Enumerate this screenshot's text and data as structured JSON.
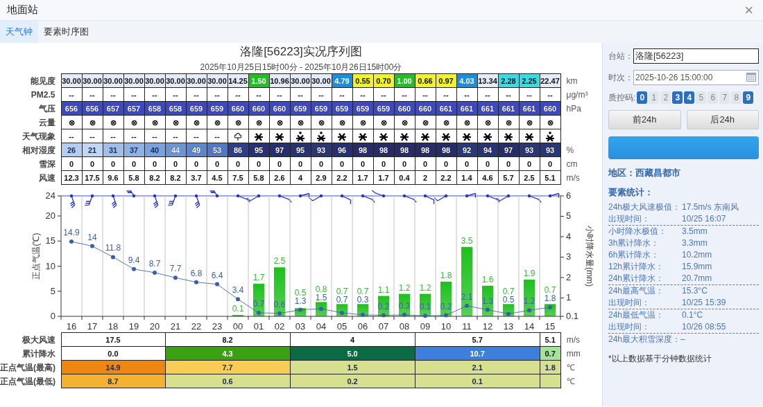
{
  "window": {
    "title": "地面站",
    "close": "×"
  },
  "tabs": [
    {
      "label": "天气钟",
      "selected": true
    },
    {
      "label": "要素时序图",
      "selected": false
    }
  ],
  "chart_title": "洛隆[56223]实况序列图",
  "chart_subtitle": "2025年10月25日15时00分 - 2025年10月26日15时00分",
  "elements_table": {
    "rows": [
      {
        "label": "能见度",
        "unit": "km",
        "kind": "plain",
        "cells": [
          {
            "text": "30.00",
            "color": "#e3ebf6"
          },
          {
            "text": "30.00",
            "color": "#e3ebf6"
          },
          {
            "text": "30.00",
            "color": "#e3ebf6"
          },
          {
            "text": "30.00",
            "color": "#e3ebf6"
          },
          {
            "text": "30.00",
            "color": "#e3ebf6"
          },
          {
            "text": "30.00",
            "color": "#e3ebf6"
          },
          {
            "text": "30.00",
            "color": "#e3ebf6"
          },
          {
            "text": "30.00",
            "color": "#e3ebf6"
          },
          {
            "text": "14.25",
            "color": "#e3ebf6"
          },
          {
            "text": "1.50",
            "color": "#22c022"
          },
          {
            "text": "10.96",
            "color": "#e3ebf6"
          },
          {
            "text": "30.00",
            "color": "#e3ebf6"
          },
          {
            "text": "30.00",
            "color": "#e3ebf6"
          },
          {
            "text": "4.79",
            "color": "#1a8fe0"
          },
          {
            "text": "0.55",
            "color": "#f2f224"
          },
          {
            "text": "0.70",
            "color": "#f2f224"
          },
          {
            "text": "1.00",
            "color": "#22c022"
          },
          {
            "text": "0.66",
            "color": "#f2f224"
          },
          {
            "text": "0.97",
            "color": "#f2f224"
          },
          {
            "text": "4.03",
            "color": "#1a8fe0"
          },
          {
            "text": "13.34",
            "color": "#e3ebf6"
          },
          {
            "text": "2.28",
            "color": "#32dfe8"
          },
          {
            "text": "2.25",
            "color": "#32dfe8"
          },
          {
            "text": "22.47",
            "color": "#e3ebf6"
          }
        ]
      },
      {
        "label": "PM2.5",
        "unit": "μg/m³",
        "kind": "plain",
        "cells": [
          {
            "text": "--"
          },
          {
            "text": "--"
          },
          {
            "text": "--"
          },
          {
            "text": "--"
          },
          {
            "text": "--"
          },
          {
            "text": "--"
          },
          {
            "text": "--"
          },
          {
            "text": "--"
          },
          {
            "text": "--"
          },
          {
            "text": "--"
          },
          {
            "text": "--"
          },
          {
            "text": "--"
          },
          {
            "text": "--"
          },
          {
            "text": "--"
          },
          {
            "text": "--"
          },
          {
            "text": "--"
          },
          {
            "text": "--"
          },
          {
            "text": "--"
          },
          {
            "text": "--"
          },
          {
            "text": "--"
          },
          {
            "text": "--"
          },
          {
            "text": "--"
          },
          {
            "text": "--"
          },
          {
            "text": "--"
          }
        ]
      },
      {
        "label": "气压",
        "unit": "hPa",
        "kind": "outlined",
        "color": "#3d48c4",
        "cells": [
          {
            "text": "656"
          },
          {
            "text": "656"
          },
          {
            "text": "657"
          },
          {
            "text": "657"
          },
          {
            "text": "658"
          },
          {
            "text": "658"
          },
          {
            "text": "659"
          },
          {
            "text": "659"
          },
          {
            "text": "660"
          },
          {
            "text": "660"
          },
          {
            "text": "660"
          },
          {
            "text": "659"
          },
          {
            "text": "659"
          },
          {
            "text": "659"
          },
          {
            "text": "659"
          },
          {
            "text": "659"
          },
          {
            "text": "660"
          },
          {
            "text": "660"
          },
          {
            "text": "661"
          },
          {
            "text": "661"
          },
          {
            "text": "661"
          },
          {
            "text": "661"
          },
          {
            "text": "661"
          },
          {
            "text": "660"
          }
        ]
      },
      {
        "label": "云量",
        "kind": "plain",
        "cells": [
          {
            "text": "⊗"
          },
          {
            "text": "⊗"
          },
          {
            "text": "⊗"
          },
          {
            "text": "⊗"
          },
          {
            "text": "⊗"
          },
          {
            "text": "⊗"
          },
          {
            "text": "⊗"
          },
          {
            "text": "⊗"
          },
          {
            "text": "⊗"
          },
          {
            "text": "⊗"
          },
          {
            "text": "⊗"
          },
          {
            "text": "⊗"
          },
          {
            "text": "⊗"
          },
          {
            "text": "⊗"
          },
          {
            "text": "⊗"
          },
          {
            "text": "⊗"
          },
          {
            "text": "⊗"
          },
          {
            "text": "⊗"
          },
          {
            "text": "⊗"
          },
          {
            "text": "⊗"
          },
          {
            "text": "⊗"
          },
          {
            "text": "⊗"
          },
          {
            "text": "⊗"
          },
          {
            "text": "⊗"
          }
        ]
      },
      {
        "label": "天气现象",
        "kind": "plain",
        "cells": [
          {
            "kind": "text",
            "text": "--"
          },
          {
            "kind": "text",
            "text": "--"
          },
          {
            "kind": "text",
            "text": "--"
          },
          {
            "kind": "text",
            "text": "--"
          },
          {
            "kind": "text",
            "text": "--"
          },
          {
            "kind": "text",
            "text": "--"
          },
          {
            "kind": "text",
            "text": "--"
          },
          {
            "kind": "text",
            "text": "--"
          },
          {
            "kind": "shower"
          },
          {
            "kind": "snow"
          },
          {
            "kind": "snow"
          },
          {
            "kind": "snow-dot"
          },
          {
            "kind": "snow-dot"
          },
          {
            "kind": "snow"
          },
          {
            "kind": "snow"
          },
          {
            "kind": "snow"
          },
          {
            "kind": "snow"
          },
          {
            "kind": "snow"
          },
          {
            "kind": "snow"
          },
          {
            "kind": "snow"
          },
          {
            "kind": "snow"
          },
          {
            "kind": "snow"
          },
          {
            "kind": "snow"
          },
          {
            "kind": "snow-dot"
          }
        ]
      },
      {
        "label": "相对湿度",
        "unit": "%",
        "kind": "outlined",
        "cells": [
          {
            "text": "26",
            "color": "#b4cdf0"
          },
          {
            "text": "21",
            "color": "#c0d6f4"
          },
          {
            "text": "31",
            "color": "#9fbfea"
          },
          {
            "text": "37",
            "color": "#8fb2e6"
          },
          {
            "text": "40",
            "color": "#7aa2de"
          },
          {
            "text": "44",
            "color": "#6a94d6"
          },
          {
            "text": "49",
            "color": "#5c86ce"
          },
          {
            "text": "53",
            "color": "#5078c4"
          },
          {
            "text": "86",
            "color": "#2e3e88"
          },
          {
            "text": "95",
            "color": "#283272"
          },
          {
            "text": "97",
            "color": "#262e6c"
          },
          {
            "text": "95",
            "color": "#283272"
          },
          {
            "text": "93",
            "color": "#2a3676"
          },
          {
            "text": "96",
            "color": "#283070"
          },
          {
            "text": "98",
            "color": "#252c68"
          },
          {
            "text": "98",
            "color": "#252c68"
          },
          {
            "text": "98",
            "color": "#252c68"
          },
          {
            "text": "98",
            "color": "#252c68"
          },
          {
            "text": "98",
            "color": "#252c68"
          },
          {
            "text": "92",
            "color": "#2b3878"
          },
          {
            "text": "94",
            "color": "#293474"
          },
          {
            "text": "97",
            "color": "#262e6c"
          },
          {
            "text": "93",
            "color": "#2a3676"
          },
          {
            "text": "93",
            "color": "#2a3676"
          }
        ]
      },
      {
        "label": "雪深",
        "unit": "cm",
        "kind": "plain",
        "cells": [
          {
            "text": "0"
          },
          {
            "text": "0"
          },
          {
            "text": "0"
          },
          {
            "text": "0"
          },
          {
            "text": "0"
          },
          {
            "text": "0"
          },
          {
            "text": "0"
          },
          {
            "text": "0"
          },
          {
            "text": "0"
          },
          {
            "text": "0"
          },
          {
            "text": "0"
          },
          {
            "text": "0"
          },
          {
            "text": "0"
          },
          {
            "text": "0"
          },
          {
            "text": "0"
          },
          {
            "text": "0"
          },
          {
            "text": "0"
          },
          {
            "text": "0"
          },
          {
            "text": "0"
          },
          {
            "text": "0"
          },
          {
            "text": "0"
          },
          {
            "text": "0"
          },
          {
            "text": "0"
          },
          {
            "text": "0"
          }
        ]
      },
      {
        "label": "风速",
        "unit": "m/s",
        "kind": "plain",
        "cells": [
          {
            "text": "12.3"
          },
          {
            "text": "17.5"
          },
          {
            "text": "9.6"
          },
          {
            "text": "5.8"
          },
          {
            "text": "8.2"
          },
          {
            "text": "8.2"
          },
          {
            "text": "3.7"
          },
          {
            "text": "4.5"
          },
          {
            "text": "7.5"
          },
          {
            "text": "5.8"
          },
          {
            "text": "2.6"
          },
          {
            "text": "4"
          },
          {
            "text": "2.9"
          },
          {
            "text": "2.2"
          },
          {
            "text": "1.7"
          },
          {
            "text": "1.7"
          },
          {
            "text": "0.4"
          },
          {
            "text": "2"
          },
          {
            "text": "2.2"
          },
          {
            "text": "1.4"
          },
          {
            "text": "4.6"
          },
          {
            "text": "5.7"
          },
          {
            "text": "2.5"
          },
          {
            "text": "5.1"
          }
        ]
      }
    ]
  },
  "chart": {
    "temperature": {
      "chart_data": {
        "type": "line",
        "categories": [
          "16",
          "17",
          "18",
          "19",
          "20",
          "21",
          "22",
          "23",
          "00",
          "01",
          "02",
          "03",
          "04",
          "05",
          "06",
          "07",
          "08",
          "09",
          "10",
          "11",
          "12",
          "13",
          "14",
          "15"
        ],
        "ylabel": "正点气温(℃)",
        "ylim": [
          0,
          24
        ],
        "yticks": [
          0,
          5,
          10,
          15,
          20,
          24
        ],
        "data_labels": true,
        "series": [
          {
            "color": "#3b5ea8",
            "marker": "o",
            "values": [
              14.9,
              14,
              11.8,
              9.4,
              8.7,
              7.7,
              6.8,
              6.4,
              3.4,
              0.7,
              0.6,
              1.3,
              1.5,
              0.7,
              0.3,
              0.2,
              0.3,
              0.1,
              0.2,
              2.1,
              1.3,
              0.5,
              1.2,
              1.8
            ]
          }
        ]
      }
    },
    "precipitation": {
      "chart_data": {
        "type": "bar",
        "ylabel": "小时降水量(mm)",
        "ylim": [
          0.1,
          6
        ],
        "yticks": [
          0.1,
          1,
          2,
          3,
          4,
          5,
          6
        ],
        "data_labels": true,
        "series": [
          {
            "color": "#1ec01e",
            "values": [
              null,
              null,
              null,
              null,
              null,
              null,
              null,
              null,
              0.1,
              1.7,
              2.5,
              0.5,
              0.8,
              0.7,
              0.7,
              1.1,
              1.2,
              1.2,
              1.8,
              3.5,
              1.6,
              0.7,
              1.9,
              0.7
            ]
          }
        ]
      }
    }
  },
  "summary_table": {
    "rows": [
      {
        "label": "极大风速",
        "unit": "m/s",
        "kind": "plain",
        "cells": [
          {
            "text": "17.5"
          },
          {
            "text": "8.2"
          },
          {
            "text": "4"
          },
          {
            "text": "5.7"
          },
          {
            "text": "5.1"
          }
        ]
      },
      {
        "label": "累计降水",
        "unit": "mm",
        "kind": "plain",
        "cells": [
          {
            "text": "0.0",
            "color": "#ffffff"
          },
          {
            "text": "4.3",
            "color": "#3ba112"
          },
          {
            "text": "5.0",
            "color": "#0b6b45"
          },
          {
            "text": "10.7",
            "color": "#3f7fdc"
          },
          {
            "text": "0.7",
            "color": "#a3e49a"
          }
        ]
      },
      {
        "label": "正点气温(最高)",
        "unit": "℃",
        "kind": "outlined",
        "cells": [
          {
            "text": "14.9",
            "color": "#ef8612"
          },
          {
            "text": "7.7",
            "color": "#f7cd55"
          },
          {
            "text": "1.5",
            "color": "#d6e08e"
          },
          {
            "text": "2.1",
            "color": "#d6e08e"
          },
          {
            "text": "1.8",
            "color": "#d6e08e"
          }
        ]
      },
      {
        "label": "正点气温(最低)",
        "unit": "℃",
        "kind": "outlined",
        "cells": [
          {
            "text": "8.7",
            "color": "#f3b232"
          },
          {
            "text": "0.6",
            "color": "#d6e08e"
          },
          {
            "text": "0.2",
            "color": "#d6e08e"
          },
          {
            "text": "0.1",
            "color": "#d6e08e"
          },
          {
            "color": "#d6e08e"
          }
        ]
      }
    ]
  },
  "panel": {
    "station": {
      "label": "台站：",
      "value": "洛隆[56223]"
    },
    "time": {
      "label": "时次：",
      "value": "2025-10-26 15:00:00"
    },
    "qc": {
      "label": "质控码:",
      "codes": [
        {
          "label": "0",
          "selected": true
        },
        {
          "label": "1",
          "selected": false
        },
        {
          "label": "2",
          "selected": false
        },
        {
          "label": "3",
          "selected": true
        },
        {
          "label": "4",
          "selected": true
        },
        {
          "label": "5",
          "selected": false
        },
        {
          "label": "6",
          "selected": false
        },
        {
          "label": "7",
          "selected": false
        },
        {
          "label": "8",
          "selected": false
        },
        {
          "label": "9",
          "selected": true
        }
      ]
    },
    "buttons": [
      "前24h",
      "后24h"
    ],
    "region": "地区：西藏昌都市",
    "stats_title": "要素统计：",
    "stats": [
      {
        "rows": [
          {
            "label": "24h极大风速极值：",
            "value": "17.5m/s 东南风"
          },
          {
            "label": "出现时间：",
            "value": "10/25 16:07"
          }
        ]
      },
      {
        "rows": [
          {
            "label": "小时降水极值：",
            "value": "3.5mm"
          },
          {
            "label": "3h累计降水：",
            "value": "3.3mm"
          },
          {
            "label": "6h累计降水：",
            "value": "10.2mm"
          },
          {
            "label": "12h累计降水：",
            "value": "15.9mm"
          },
          {
            "label": "24h累计降水：",
            "value": "20.7mm"
          }
        ]
      },
      {
        "rows": [
          {
            "label": "24h最高气温：",
            "value": "15.3°C"
          },
          {
            "label": "出现时间：",
            "value": "10/25 15:39"
          }
        ]
      },
      {
        "rows": [
          {
            "label": "24h最低气温：",
            "value": "0.1°C"
          },
          {
            "label": "出现时间：",
            "value": "10/26 08:55"
          }
        ]
      },
      {
        "rows": [
          {
            "label": "24h最大积雪深度：–"
          }
        ]
      }
    ],
    "note": "*以上数据基于分钟数据统计"
  }
}
